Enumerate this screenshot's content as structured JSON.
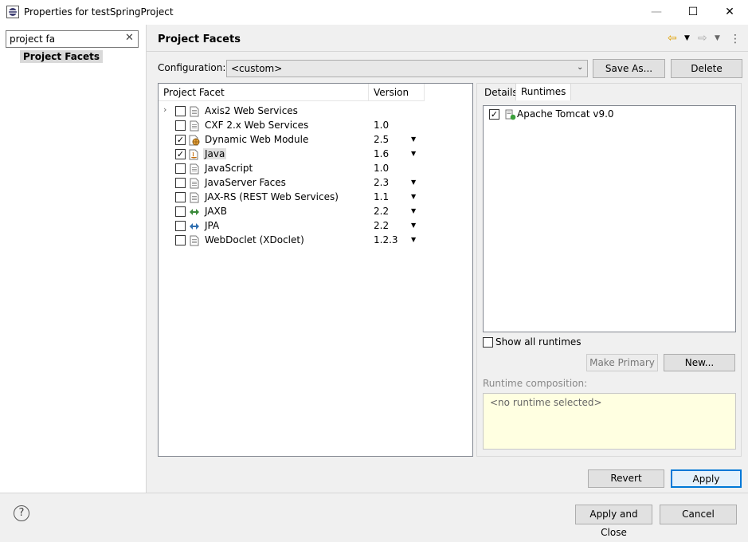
{
  "window": {
    "title": "Properties for testSpringProject",
    "minimize": "—",
    "maximize": "☐",
    "close": "✕"
  },
  "left": {
    "filter_value": "project fa",
    "tree_item": "Project Facets"
  },
  "header": {
    "title": "Project Facets"
  },
  "configuration": {
    "label": "Configuration:",
    "value": "<custom>",
    "save_as": "Save As...",
    "delete": "Delete"
  },
  "table": {
    "col_facet": "Project Facet",
    "col_version": "Version",
    "rows": [
      {
        "name": "Axis2 Web Services",
        "version": "",
        "checked": false,
        "expandable": true,
        "dropdown": false,
        "icon": "document-icon"
      },
      {
        "name": "CXF 2.x Web Services",
        "version": "1.0",
        "checked": false,
        "expandable": false,
        "dropdown": false,
        "icon": "document-icon"
      },
      {
        "name": "Dynamic Web Module",
        "version": "2.5",
        "checked": true,
        "expandable": false,
        "dropdown": true,
        "icon": "web-module-icon"
      },
      {
        "name": "Java",
        "version": "1.6",
        "checked": true,
        "expandable": false,
        "dropdown": true,
        "icon": "java-icon",
        "selected": true
      },
      {
        "name": "JavaScript",
        "version": "1.0",
        "checked": false,
        "expandable": false,
        "dropdown": false,
        "icon": "document-icon"
      },
      {
        "name": "JavaServer Faces",
        "version": "2.3",
        "checked": false,
        "expandable": false,
        "dropdown": true,
        "icon": "document-icon"
      },
      {
        "name": "JAX-RS (REST Web Services)",
        "version": "1.1",
        "checked": false,
        "expandable": false,
        "dropdown": true,
        "icon": "document-icon"
      },
      {
        "name": "JAXB",
        "version": "2.2",
        "checked": false,
        "expandable": false,
        "dropdown": true,
        "icon": "jaxb-icon"
      },
      {
        "name": "JPA",
        "version": "2.2",
        "checked": false,
        "expandable": false,
        "dropdown": true,
        "icon": "jpa-icon"
      },
      {
        "name": "WebDoclet (XDoclet)",
        "version": "1.2.3",
        "checked": false,
        "expandable": false,
        "dropdown": true,
        "icon": "document-icon"
      }
    ]
  },
  "tabs": {
    "details": "Details",
    "runtimes": "Runtimes"
  },
  "runtimes": {
    "items": [
      {
        "name": "Apache Tomcat v9.0",
        "checked": true
      }
    ],
    "show_all": "Show all runtimes",
    "make_primary": "Make Primary",
    "new": "New...",
    "composition_label": "Runtime composition:",
    "composition_value": "<no runtime selected>"
  },
  "footer": {
    "revert": "Revert",
    "apply": "Apply",
    "apply_close": "Apply and Close",
    "cancel": "Cancel",
    "help": "?"
  }
}
